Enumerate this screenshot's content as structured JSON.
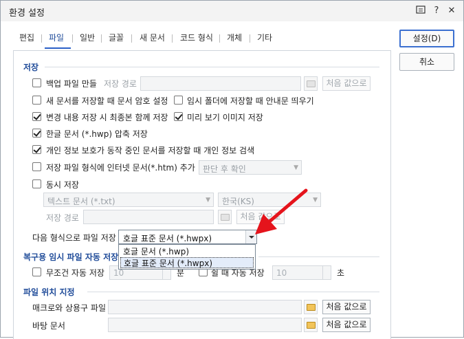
{
  "window": {
    "title": "환경 설정",
    "help_icon": "?",
    "close_icon": "✕"
  },
  "tabs": [
    "편집",
    "파일",
    "일반",
    "글꼴",
    "새 문서",
    "코드 형식",
    "개체",
    "기타"
  ],
  "active_tab": "파일",
  "buttons": {
    "ok": "설정(D)",
    "cancel": "취소"
  },
  "save_section": {
    "title": "저장",
    "backup": {
      "label": "백업 파일 만들",
      "checked": false,
      "path_label": "저장 경로",
      "reset": "처음 값으로"
    },
    "new_doc_password": {
      "label": "새 문서를 저장할 때 문서 암호 설정",
      "checked": false
    },
    "temp_folder_notice": {
      "label": "임시 폴더에 저장할 때 안내문 띄우기",
      "checked": false
    },
    "save_changes_only": {
      "label": "변경 내용 저장 시 최종본 함께 저장",
      "checked": true
    },
    "preview_image": {
      "label": "미리 보기 이미지 저장",
      "checked": true
    },
    "compress_hwp": {
      "label": "한글 문서 (*.hwp) 압축 저장",
      "checked": true
    },
    "privacy_search": {
      "label": "개인 정보 보호가 동작 중인 문서를 저장할 때 개인 정보 검색",
      "checked": true
    },
    "add_htm": {
      "label": "저장 파일 형식에 인터넷 문서(*.htm) 추가",
      "checked": false,
      "option": "판단 후 확인"
    },
    "simultaneous": {
      "label": "동시 저장",
      "checked": false,
      "format": "텍스트 문서 (*.txt)",
      "encoding": "한국(KS)",
      "path_label": "저장 경로",
      "reset": "처음 값으로"
    },
    "save_as_format": {
      "label": "다음 형식으로 파일 저장",
      "value": "호글 표준 문서 (*.hwpx)",
      "options": [
        "호글 문서 (*.hwp)",
        "호글 표준 문서 (*.hwpx)"
      ],
      "selected_index": 1
    }
  },
  "autosave_section": {
    "title": "복구용 임시 파일 자동 저장",
    "unconditional": {
      "label": "무조건 자동 저장",
      "checked": false,
      "value": "10",
      "unit": "분"
    },
    "idle": {
      "label": "쉴 때 자동 저장",
      "checked": false,
      "value": "10",
      "unit": "초"
    }
  },
  "location_section": {
    "title": "파일 위치 지정",
    "macro": {
      "label": "매크로와 상용구 파일",
      "reset": "처음 값으로"
    },
    "background": {
      "label": "바탕 문서",
      "reset": "처음 값으로"
    }
  },
  "colors": {
    "accent": "#2a5fc7",
    "section_title": "#1f4b99",
    "arrow": "#e5141c"
  }
}
